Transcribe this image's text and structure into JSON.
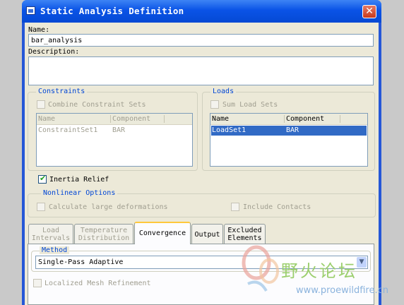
{
  "window": {
    "title": "Static Analysis Definition",
    "close_glyph": "✕"
  },
  "name": {
    "label": "Name:",
    "value": "bar_analysis"
  },
  "description": {
    "label": "Description:",
    "value": ""
  },
  "constraints": {
    "title": "Constraints",
    "combine_label": "Combine Constraint Sets",
    "combine_checked": false,
    "columns": [
      "Name",
      "Component"
    ],
    "rows": [
      {
        "name": "ConstraintSet1",
        "component": "BAR"
      }
    ]
  },
  "loads": {
    "title": "Loads",
    "sum_label": "Sum Load Sets",
    "sum_checked": false,
    "columns": [
      "Name",
      "Component"
    ],
    "rows": [
      {
        "name": "LoadSet1",
        "component": "BAR",
        "selected": true
      }
    ]
  },
  "inertia_relief": {
    "label": "Inertia Relief",
    "checked": true
  },
  "nonlinear": {
    "title": "Nonlinear Options",
    "large_deformations_label": "Calculate large deformations",
    "include_contacts_label": "Include Contacts"
  },
  "tabs": [
    {
      "line1": "Load",
      "line2": "Intervals",
      "active": false,
      "enabled": false
    },
    {
      "line1": "Temperature",
      "line2": "Distribution",
      "active": false,
      "enabled": false
    },
    {
      "line1": "Convergence",
      "line2": "",
      "active": true,
      "enabled": true
    },
    {
      "line1": "Output",
      "line2": "",
      "active": false,
      "enabled": true
    },
    {
      "line1": "Excluded",
      "line2": "Elements",
      "active": false,
      "enabled": true
    }
  ],
  "method": {
    "title": "Method",
    "value": "Single-Pass Adaptive"
  },
  "localized_mesh": {
    "label": "Localized Mesh Refinement"
  },
  "watermark": {
    "text": "野火论坛",
    "url": "www.proewildfire.cn"
  },
  "icons": {
    "window": "window-icon",
    "close": "close-icon",
    "dropdown": "chevron-down-icon",
    "check": "checkmark-icon"
  }
}
